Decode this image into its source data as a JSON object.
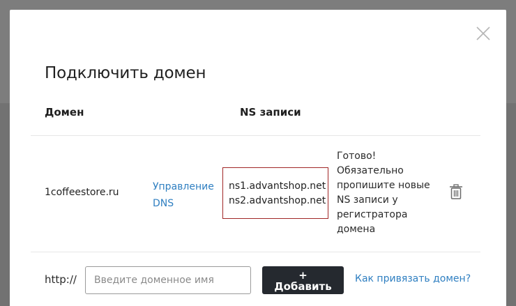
{
  "modal": {
    "title": "Подключить домен",
    "close_icon": "close-icon"
  },
  "table": {
    "headers": {
      "domain": "Домен",
      "ns": "NS записи"
    },
    "row": {
      "domain": "1coffeestore.ru",
      "dns_link_line1": "Управление",
      "dns_link_line2": "DNS",
      "ns": [
        "ns1.advantshop.net",
        "ns2.advantshop.net"
      ],
      "note": "Готово! Обязательно пропишите новые NS записи у регистратора домена",
      "delete_icon": "trash-icon"
    }
  },
  "add_form": {
    "prefix": "http://",
    "placeholder": "Введите доменное имя",
    "button_plus": "+",
    "button_label": "Добавить",
    "help_link": "Как привязать домен?"
  },
  "colors": {
    "link": "#2f7fc1",
    "ns_box_border": "#a02626",
    "button_bg": "#25292f"
  }
}
